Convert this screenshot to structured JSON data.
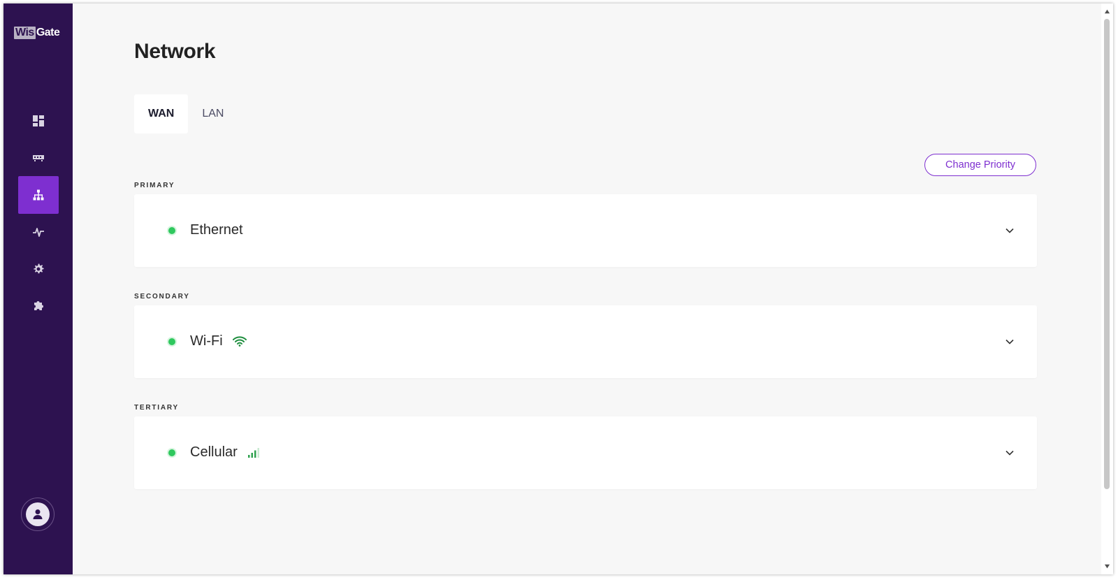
{
  "brand": {
    "part1": "Wis",
    "part2": "Gate"
  },
  "sidebar": {
    "items": [
      {
        "id": "dashboard",
        "icon": "dashboard-icon",
        "active": false
      },
      {
        "id": "devices",
        "icon": "router-icon",
        "active": false
      },
      {
        "id": "network",
        "icon": "network-icon",
        "active": true
      },
      {
        "id": "diagnostics",
        "icon": "activity-icon",
        "active": false
      },
      {
        "id": "settings",
        "icon": "gear-icon",
        "active": false
      },
      {
        "id": "extensions",
        "icon": "puzzle-icon",
        "active": false
      }
    ],
    "profile_icon": "user-icon"
  },
  "page": {
    "title": "Network"
  },
  "tabs": [
    {
      "label": "WAN",
      "active": true
    },
    {
      "label": "LAN",
      "active": false
    }
  ],
  "actions": {
    "change_priority": "Change Priority"
  },
  "sections": [
    {
      "label": "PRIMARY",
      "card": {
        "title": "Ethernet",
        "status": "connected",
        "signal_icon": ""
      }
    },
    {
      "label": "SECONDARY",
      "card": {
        "title": "Wi-Fi",
        "status": "connected",
        "signal_icon": "wifi-icon"
      }
    },
    {
      "label": "TERTIARY",
      "card": {
        "title": "Cellular",
        "status": "connected",
        "signal_icon": "cellular-signal-icon"
      }
    }
  ],
  "colors": {
    "sidebar": "#2d1250",
    "accent": "#7e2fd0",
    "status_ok": "#2fc85e",
    "signal": "#1e8e3e"
  }
}
